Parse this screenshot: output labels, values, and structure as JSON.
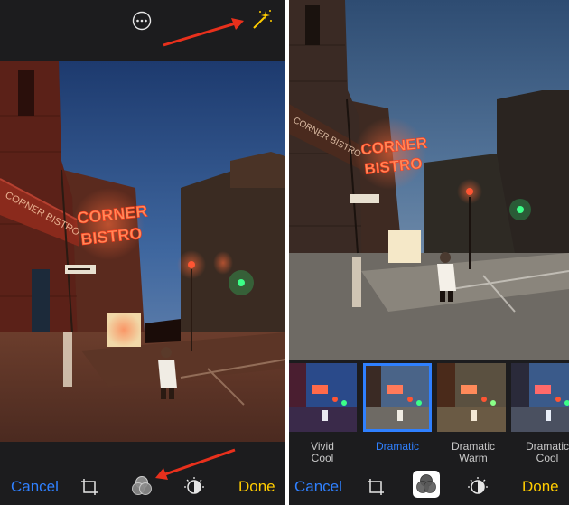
{
  "left_panel": {
    "cancel_label": "Cancel",
    "done_label": "Done"
  },
  "right_panel": {
    "cancel_label": "Cancel",
    "done_label": "Done",
    "filters": [
      {
        "name_line1": "Vivid",
        "name_line2": "Cool",
        "selected": false
      },
      {
        "name_line1": "Dramatic",
        "name_line2": "",
        "selected": true
      },
      {
        "name_line1": "Dramatic",
        "name_line2": "Warm",
        "selected": false
      },
      {
        "name_line1": "Dramatic",
        "name_line2": "Cool",
        "selected": false
      }
    ]
  },
  "photo_sign": {
    "line1": "CORNER",
    "line2": "BISTRO",
    "awning": "CORNER BISTRO"
  },
  "colors": {
    "accent_blue": "#2f80ff",
    "done_yellow": "#ffcc00",
    "annotation_red": "#e8301c",
    "toolbar_bg": "#1c1c1e"
  }
}
